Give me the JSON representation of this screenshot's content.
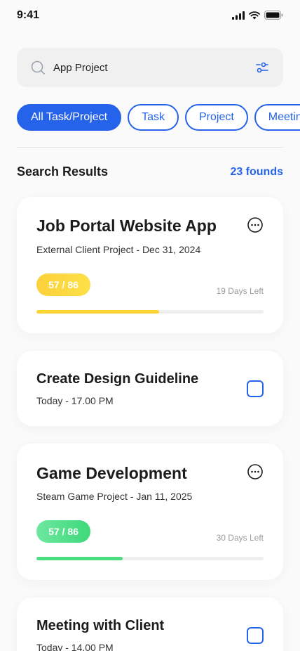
{
  "status": {
    "time": "9:41"
  },
  "search": {
    "value": "App Project",
    "placeholder": "Search"
  },
  "chips": [
    "All Task/Project",
    "Task",
    "Project",
    "Meeting"
  ],
  "results": {
    "title": "Search Results",
    "count": "23 founds"
  },
  "cards": [
    {
      "title": "Job Portal Website App",
      "subtitle": "External Client Project - Dec 31, 2024",
      "badge": "57 / 86",
      "days_left": "19 Days Left",
      "progress": 0.54,
      "accent": "#fcd535"
    },
    {
      "title": "Create Design Guideline",
      "subtitle": "Today - 17.00 PM"
    },
    {
      "title": "Game Development",
      "subtitle": "Steam Game Project - Jan 11, 2025",
      "badge": "57 / 86",
      "days_left": "30 Days Left",
      "progress": 0.38,
      "accent": "#4ade80"
    },
    {
      "title": "Meeting with Client",
      "subtitle": "Today - 14.00 PM"
    }
  ],
  "colors": {
    "primary": "#2563eb",
    "yellow": "#fcd535",
    "green": "#4ade80"
  }
}
